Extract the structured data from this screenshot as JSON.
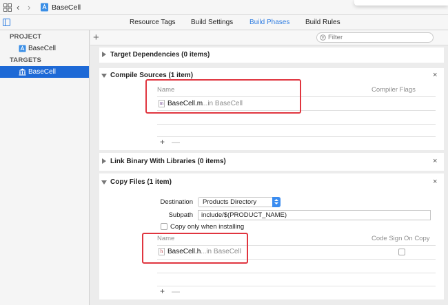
{
  "jumpbar": {
    "breadcrumb": "BaseCell"
  },
  "tabs": [
    {
      "label": "Resource Tags"
    },
    {
      "label": "Build Settings"
    },
    {
      "label": "Build Phases"
    },
    {
      "label": "Build Rules"
    }
  ],
  "active_tab": "Build Phases",
  "sidebar": {
    "project_header": "PROJECT",
    "project_item": "BaseCell",
    "targets_header": "TARGETS",
    "target_item": "BaseCell"
  },
  "search": {
    "placeholder": "Filter"
  },
  "phases": {
    "target_dependencies": {
      "title": "Target Dependencies (0 items)"
    },
    "compile_sources": {
      "title": "Compile Sources (1 item)",
      "col_name": "Name",
      "col_flags": "Compiler Flags",
      "file_icon": "m",
      "file_name": "BaseCell.m",
      "file_location": "...in BaseCell"
    },
    "link_binary": {
      "title": "Link Binary With Libraries (0 items)"
    },
    "copy_files": {
      "title": "Copy Files (1 item)",
      "destination_label": "Destination",
      "destination_value": "Products Directory",
      "subpath_label": "Subpath",
      "subpath_value": "include/$(PRODUCT_NAME)",
      "copy_only_label": "Copy only when installing",
      "col_name": "Name",
      "col_codesign": "Code Sign On Copy",
      "file_icon": "h",
      "file_name": "BaseCell.h",
      "file_location": "...in BaseCell"
    }
  },
  "symbols": {
    "close": "×",
    "add": "+",
    "remove": "—",
    "back": "‹",
    "forward": "›"
  },
  "colors": {
    "accent": "#2f7de1",
    "selection": "#1d69d6",
    "annotation": "#e0353f"
  }
}
